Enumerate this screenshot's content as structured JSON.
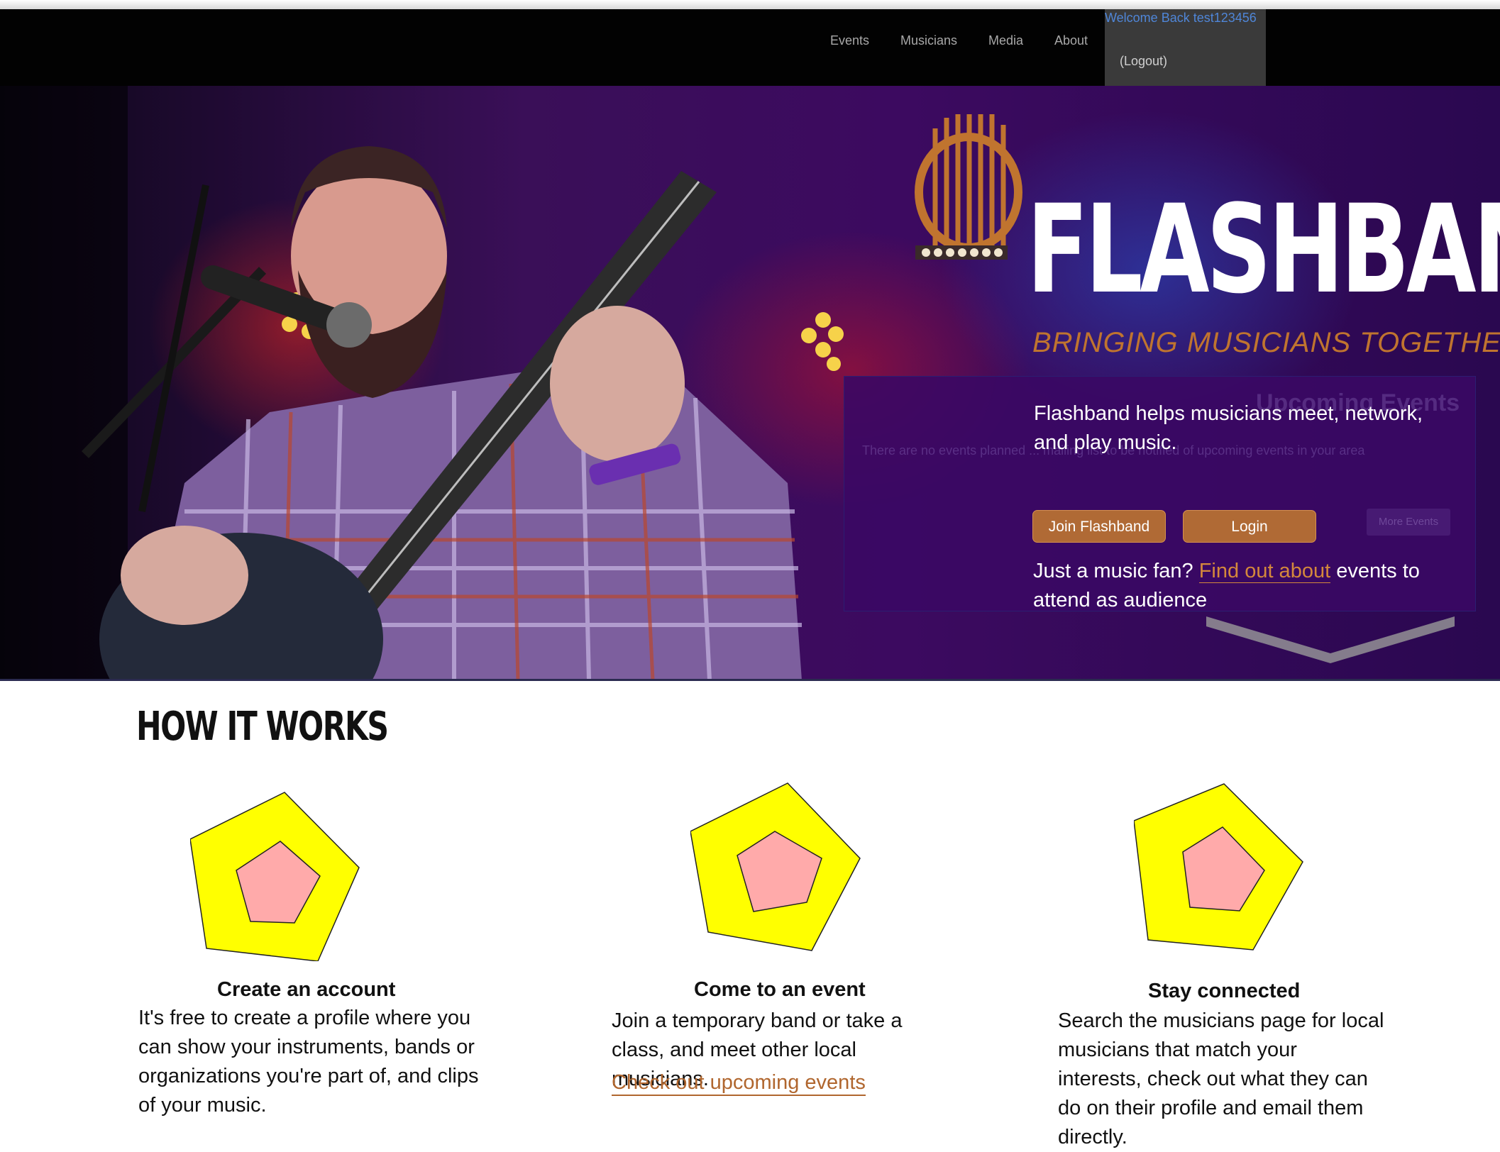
{
  "nav": {
    "links": [
      "Events",
      "Musicians",
      "Media",
      "About"
    ],
    "welcome": "Welcome Back test123456",
    "logout": "(Logout)",
    "link_color": "#a8a8a8",
    "welcome_color": "#4f86d8"
  },
  "hero": {
    "logo_text": "FLASHBAND",
    "tagline": "BRINGING MUSICIANS TOGETHER",
    "ghost_title": "Upcoming Events",
    "ghost_text": "There are no events planned ... mailing list to be notified of upcoming events in your area",
    "ghost_button": "More Events",
    "description": "Flashband helps musicians meet, network, and play music.",
    "join_button": "Join Flashband",
    "login_button": "Login",
    "fan_prefix": "Just a music fan?",
    "fan_link": "Find out about",
    "fan_suffix": "events to attend as audience",
    "accent_color": "#b06a35",
    "panel_color": "#3a0864"
  },
  "how_it_works": {
    "title": "HOW IT WORKS",
    "steps": [
      {
        "title": "Create an account",
        "description": "It's free to create a profile where you can show your instruments, bands or organizations you're part of, and clips of your music.",
        "icon": "pentagon-icon"
      },
      {
        "title": "Come to an event",
        "description": "Join a temporary band or take a class, and meet other local musicians.",
        "link": "Check out upcoming events",
        "icon": "pentagon-icon"
      },
      {
        "title": "Stay connected",
        "description": "Search the musicians page for local musicians that match your interests, check out what they can do on their profile and email them directly.",
        "icon": "pentagon-icon"
      }
    ],
    "icon_outer_color": "#ffff00",
    "icon_inner_color": "#ffaaaa"
  }
}
